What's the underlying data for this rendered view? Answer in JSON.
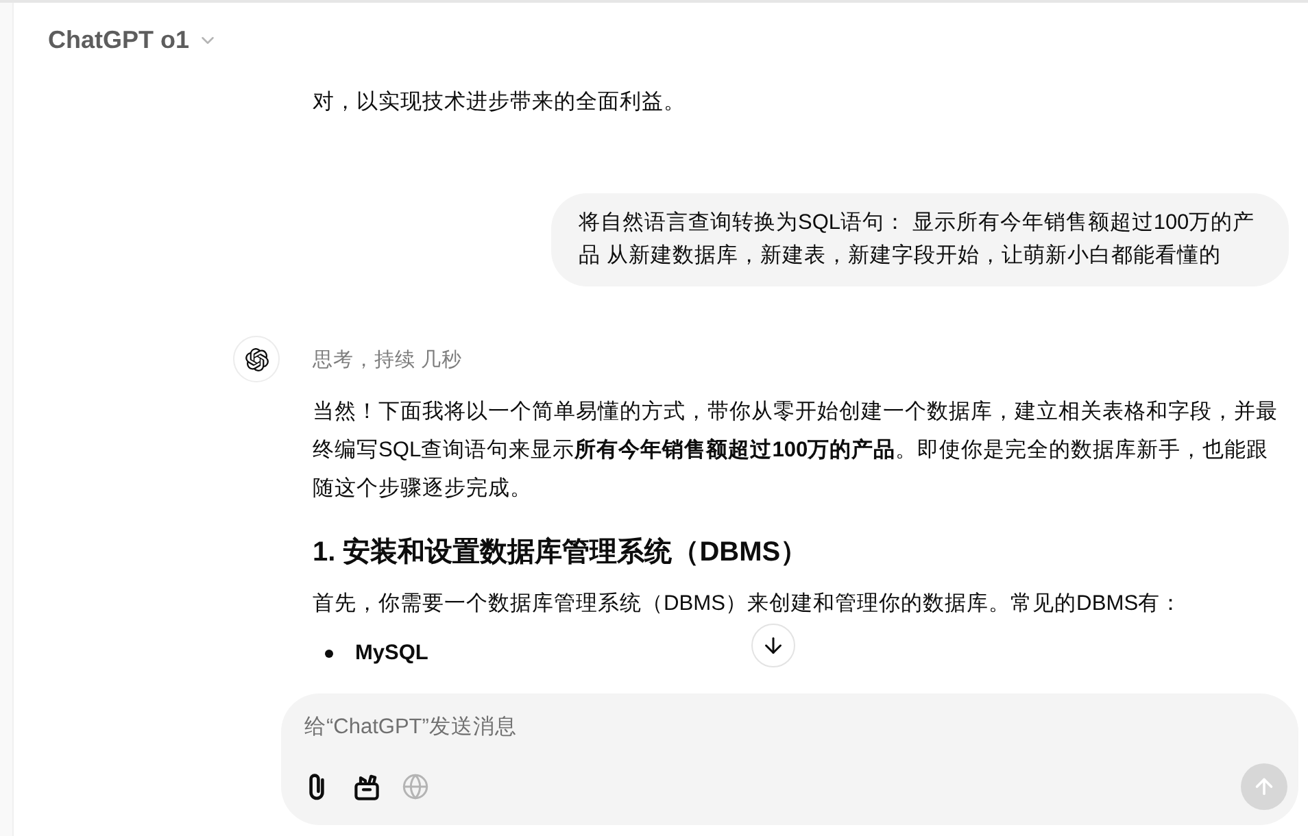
{
  "header": {
    "model": "ChatGPT o1"
  },
  "conversation": [
    {
      "kind": "assistant",
      "avatar": false,
      "blocks": [
        {
          "kind": "paragraph",
          "text": "对，以实现技术进步带来的全面利益。"
        }
      ]
    },
    {
      "kind": "user",
      "text": "将自然语言查询转换为SQL语句： 显示所有今年销售额超过100万的产品 从新建数据库，新建表，新建字段开始，让萌新小白都能看懂的"
    },
    {
      "kind": "assistant",
      "avatar": true,
      "status": "思考，持续 几秒",
      "blocks": [
        {
          "kind": "paragraph",
          "text": "当然！下面我将以一个简单易懂的方式，带你从零开始创建一个数据库，建立相关表格和字段，并最终编写SQL查询语句来显示**所有今年销售额超过100万的产品**。即使你是完全的数据库新手，也能跟随这个步骤逐步完成。"
        },
        {
          "kind": "heading",
          "text": "1. 安装和设置数据库管理系统（DBMS）"
        },
        {
          "kind": "paragraph",
          "text": "首先，你需要一个数据库管理系统（DBMS）来创建和管理你的数据库。常见的DBMS有："
        },
        {
          "kind": "bullets",
          "items": [
            "MySQL"
          ]
        }
      ]
    }
  ],
  "composer": {
    "placeholder": "给“ChatGPT”发送消息",
    "tools": [
      {
        "kind": "attach",
        "disabled": false
      },
      {
        "kind": "toolbox",
        "disabled": false
      },
      {
        "kind": "web-search",
        "disabled": true
      }
    ],
    "send": {
      "disabled": true
    }
  }
}
